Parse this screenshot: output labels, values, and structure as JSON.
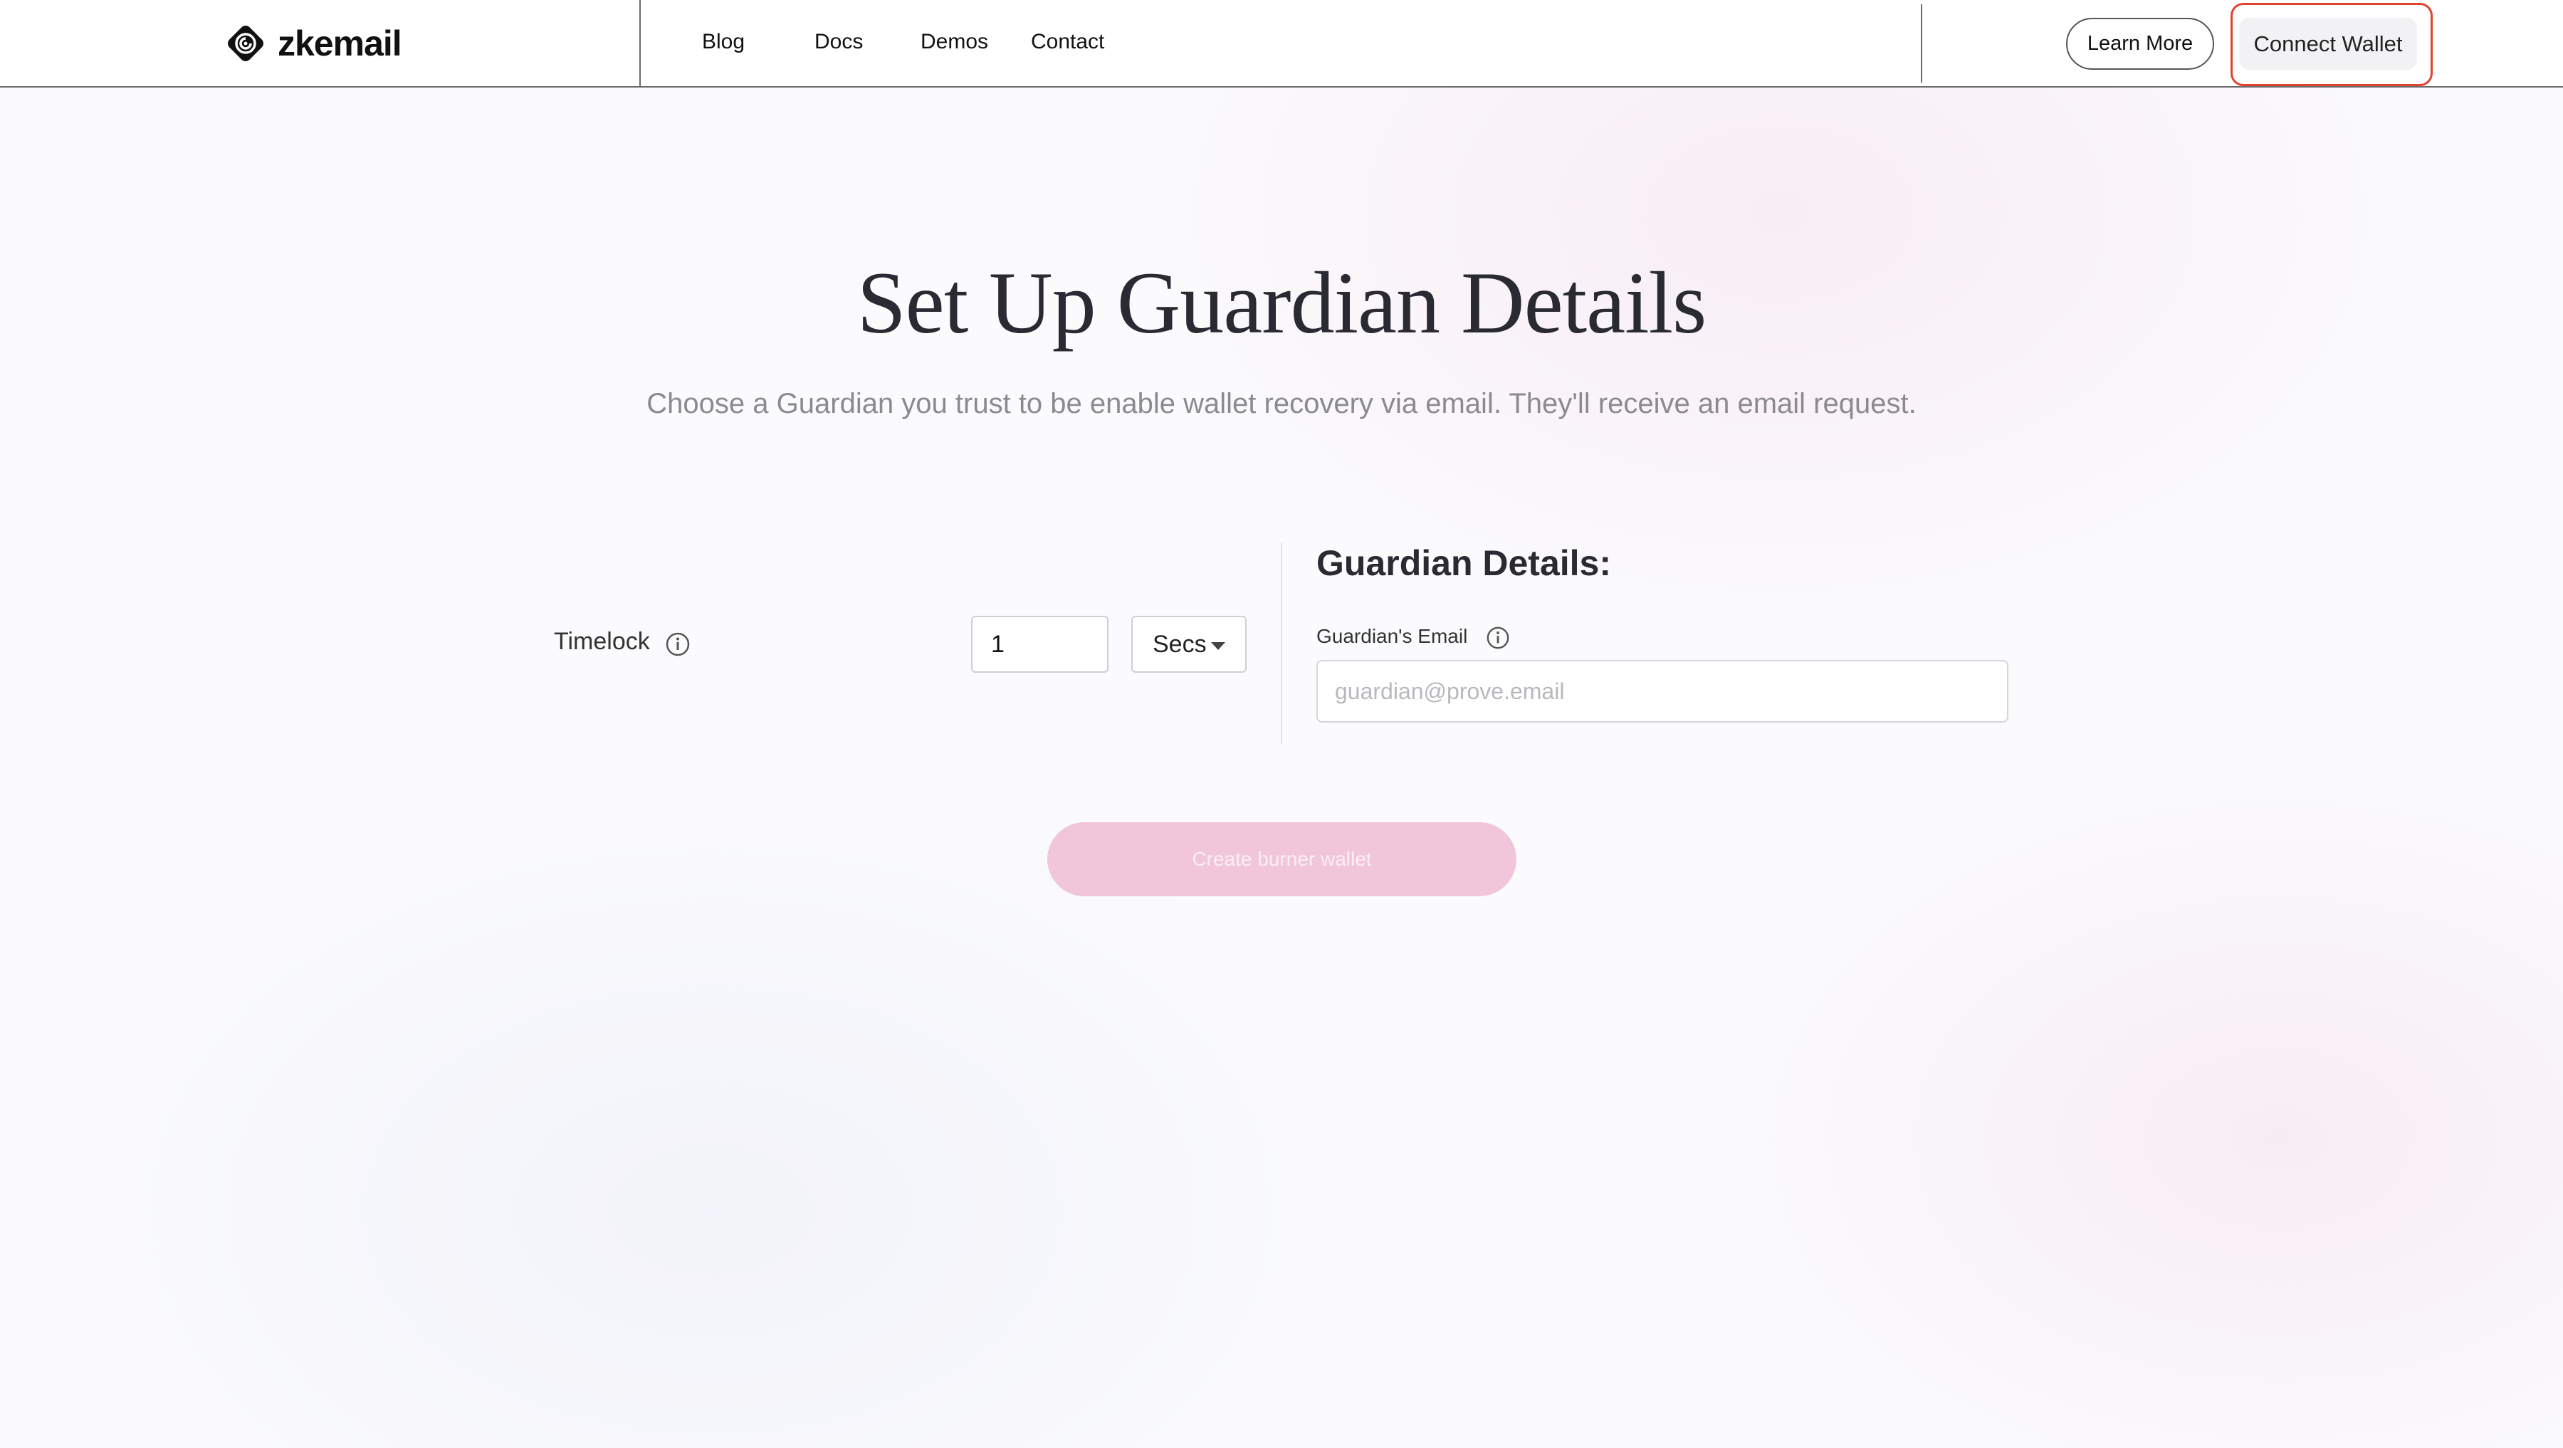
{
  "header": {
    "brand": "zkemail",
    "nav": [
      {
        "label": "Blog"
      },
      {
        "label": "Docs"
      },
      {
        "label": "Demos"
      },
      {
        "label": "Contact"
      }
    ],
    "learn_more_label": "Learn More",
    "connect_wallet_label": "Connect Wallet",
    "connect_highlight_color": "#e0442c"
  },
  "main": {
    "title": "Set Up Guardian Details",
    "subtitle": "Choose a Guardian you trust to be enable wallet recovery via email. They'll receive an email request.",
    "timelock": {
      "label": "Timelock",
      "value": "1",
      "unit": "Secs",
      "info_icon": "info-icon"
    },
    "guardian": {
      "heading": "Guardian Details:",
      "email_label": "Guardian's Email",
      "email_placeholder": "guardian@prove.email",
      "email_value": ""
    },
    "create_button_label": "Create burner wallet",
    "accent_color": "#f1c6db"
  }
}
